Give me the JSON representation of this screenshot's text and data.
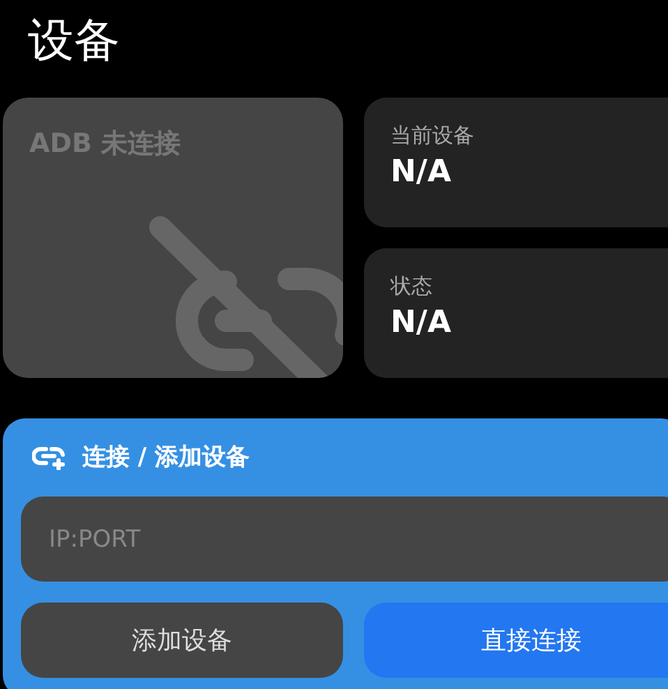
{
  "page_title": "设备",
  "adb_card": {
    "status": "ADB 未连接",
    "connected": false
  },
  "info_cards": [
    {
      "label": "当前设备",
      "value": "N/A"
    },
    {
      "label": "状态",
      "value": "N/A"
    }
  ],
  "connect_panel": {
    "title": "连接 / 添加设备",
    "input": {
      "placeholder": "IP:PORT"
    },
    "buttons": [
      {
        "label": "添加设备",
        "kind": "secondary"
      },
      {
        "label": "直接连接",
        "kind": "primary"
      }
    ]
  }
}
